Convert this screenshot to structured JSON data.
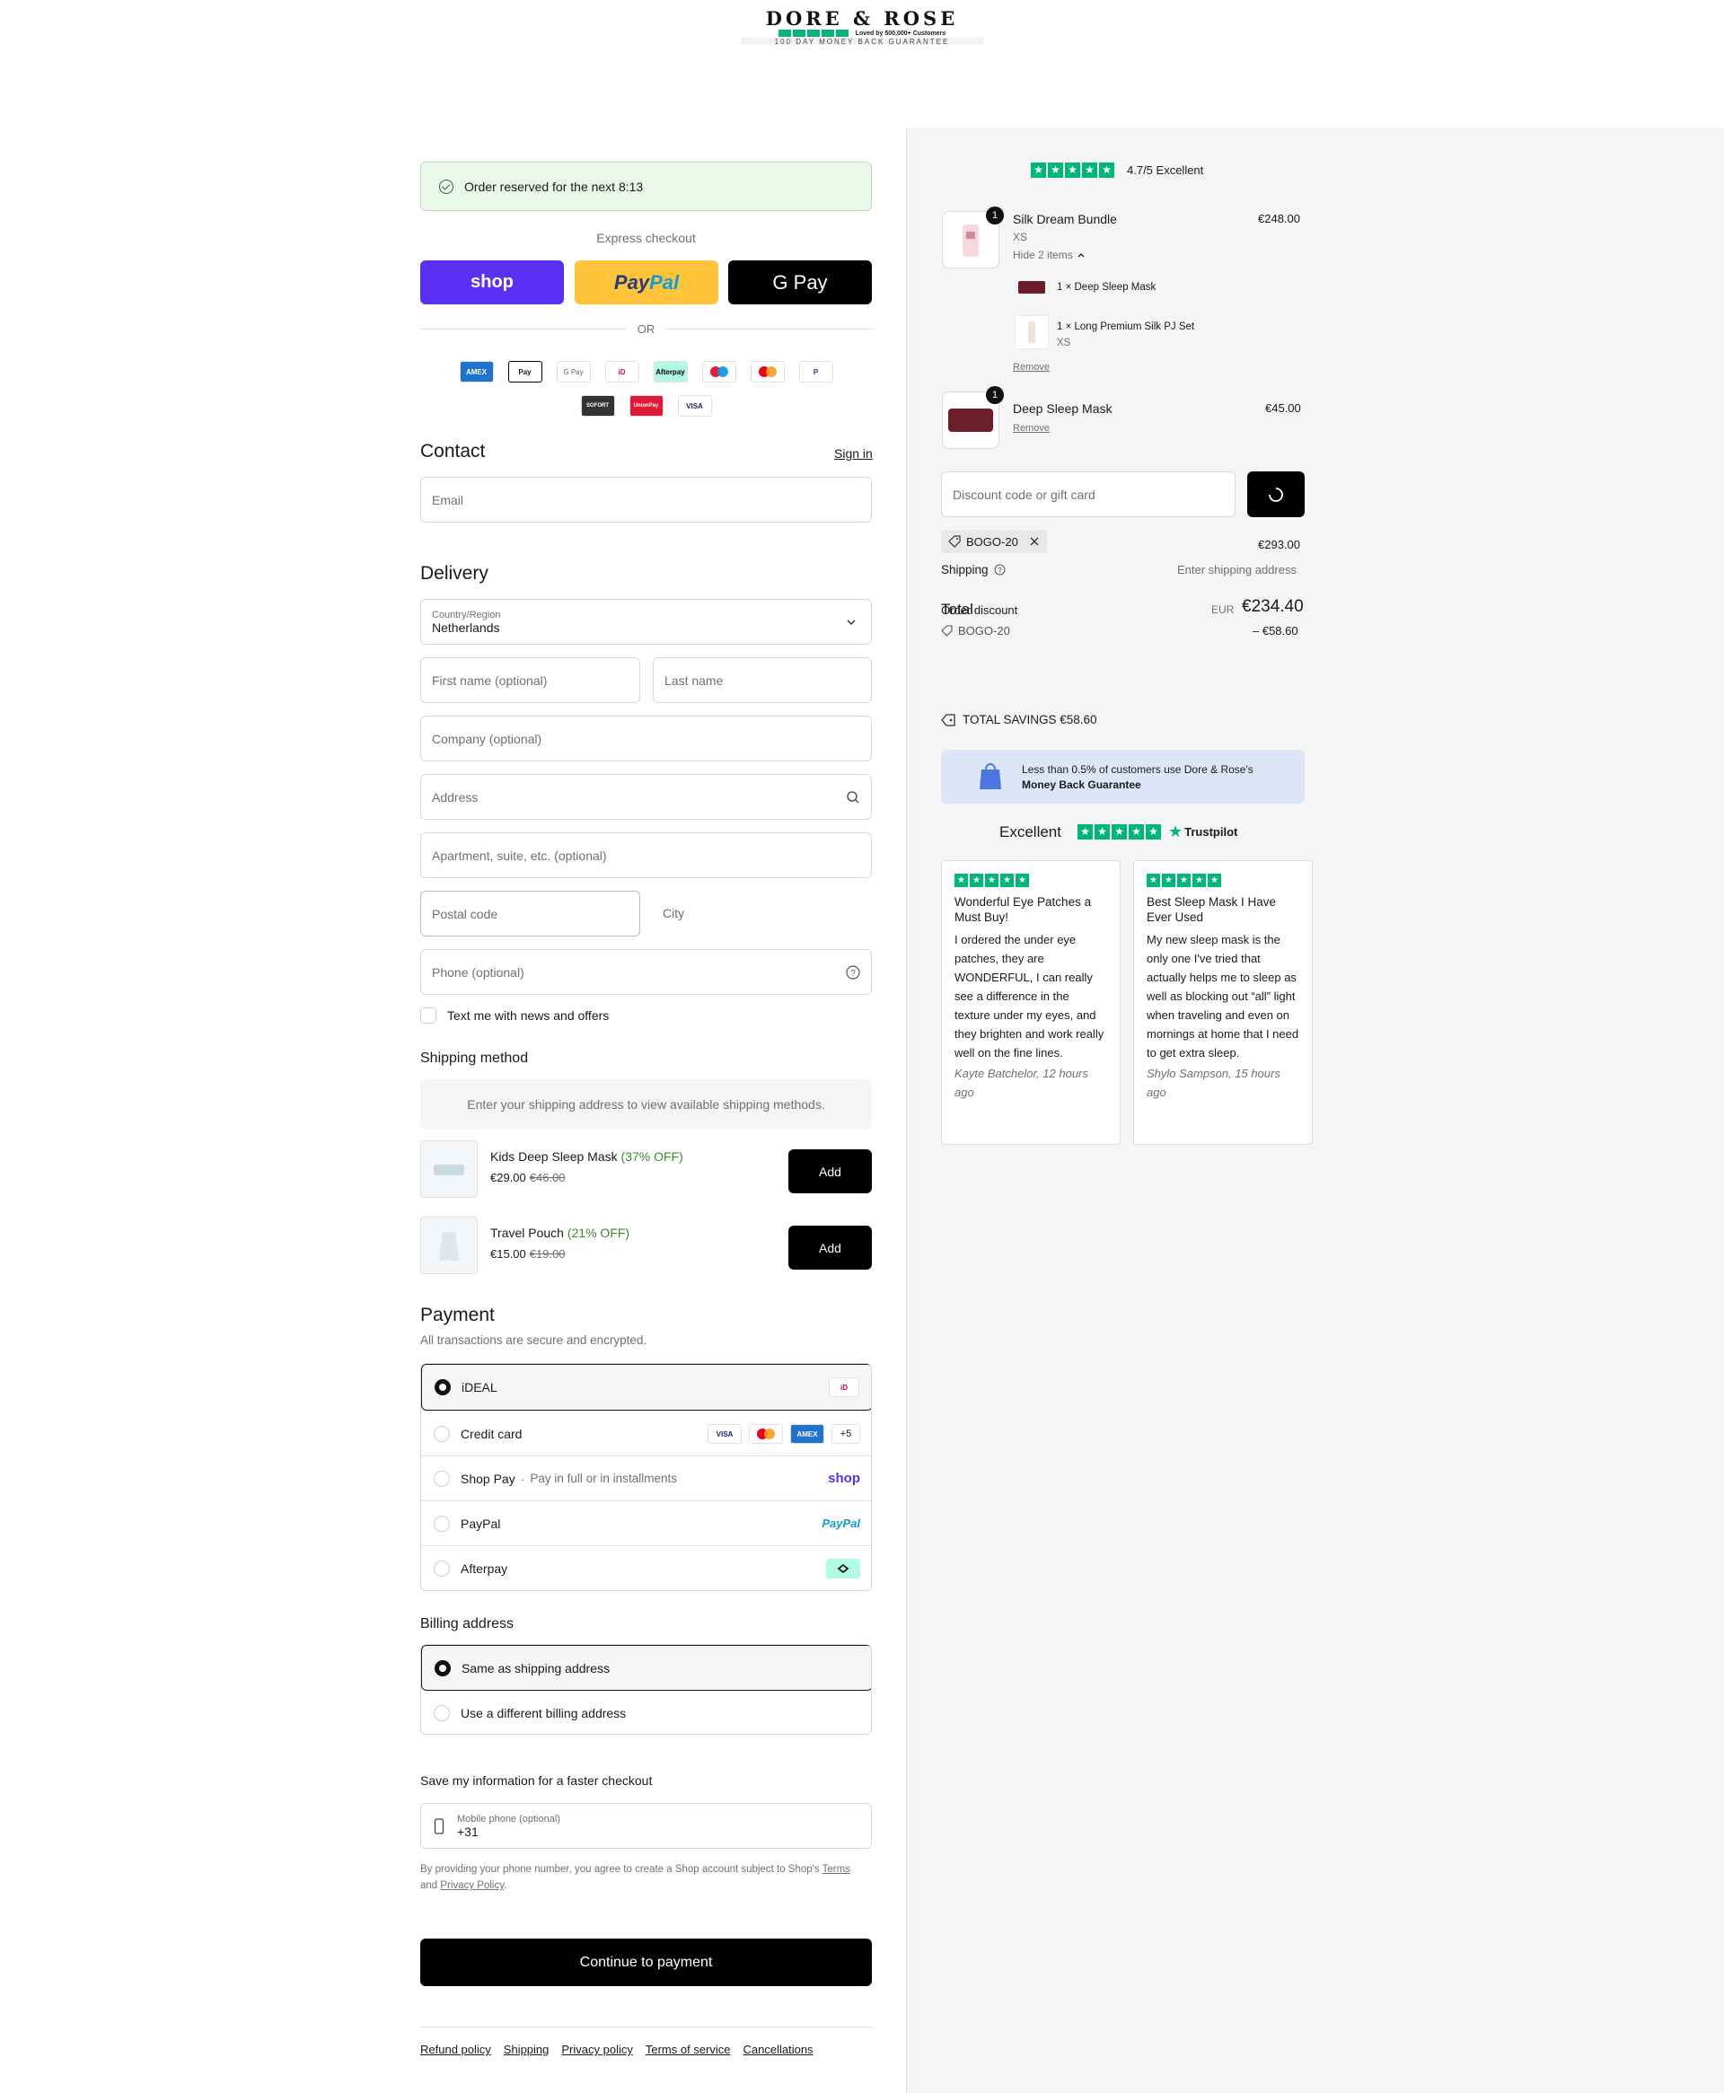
{
  "header": {
    "brand": "DORE & ROSE",
    "loved": "Loved by 500,000+ Customers",
    "guarantee": "100 DAY MONEY BACK GUARANTEE"
  },
  "reservation": {
    "text": "Order reserved for the next 8:13"
  },
  "express": {
    "label": "Express checkout",
    "shop": "shop",
    "paypal_a": "Pay",
    "paypal_b": "Pal",
    "gpay": "G Pay",
    "or": "OR"
  },
  "payment_icons": [
    "AMEX",
    "Pay",
    "G Pay",
    "iD",
    "Afterpay",
    "Maestro",
    "Mastercard",
    "P",
    "SOFORT",
    "UnionPay",
    "VISA"
  ],
  "contact": {
    "title": "Contact",
    "sign_in": "Sign in",
    "email_placeholder": "Email"
  },
  "delivery": {
    "title": "Delivery",
    "country_label": "Country/Region",
    "country_value": "Netherlands",
    "first_name": "First name (optional)",
    "last_name": "Last name",
    "company": "Company (optional)",
    "address": "Address",
    "apartment": "Apartment, suite, etc. (optional)",
    "postal": "Postal code",
    "city": "City",
    "phone": "Phone (optional)",
    "text_me": "Text me with news and offers"
  },
  "shipping": {
    "title": "Shipping method",
    "notice": "Enter your shipping address to view available shipping methods."
  },
  "upsells": [
    {
      "name": "Kids Deep Sleep Mask",
      "off": "(37% OFF)",
      "price": "€29.00",
      "was": "€46.00",
      "button": "Add"
    },
    {
      "name": "Travel Pouch",
      "off": "(21% OFF)",
      "price": "€15.00",
      "was": "€19.00",
      "button": "Add"
    }
  ],
  "payment": {
    "title": "Payment",
    "subtitle": "All transactions are secure and encrypted.",
    "options": [
      {
        "label": "iDEAL",
        "selected": true
      },
      {
        "label": "Credit card",
        "selected": false
      },
      {
        "label": "Shop Pay",
        "suffix": "Pay in full or in installments",
        "selected": false
      },
      {
        "label": "PayPal",
        "selected": false
      },
      {
        "label": "Afterpay",
        "selected": false
      }
    ],
    "card_more": "+5",
    "shop_logo": "shop",
    "paypal_logo": "PayPal",
    "visa": "VISA",
    "amex": "AMEX",
    "ideal": "iD"
  },
  "billing": {
    "title": "Billing address",
    "same": "Same as shipping address",
    "different": "Use a different billing address"
  },
  "save_info": {
    "title": "Save my information for a faster checkout",
    "mobile_label": "Mobile phone (optional)",
    "mobile_value": "+31",
    "legal_a": "By providing your phone number, you agree to create a Shop account subject to Shop's",
    "terms": "Terms",
    "legal_b": "and",
    "privacy": "Privacy Policy",
    "legal_end": "."
  },
  "cta": {
    "label": "Continue to payment"
  },
  "footer": {
    "links": [
      "Refund policy",
      "Shipping",
      "Privacy policy",
      "Terms of service",
      "Cancellations"
    ]
  },
  "summary": {
    "rating": "4.7/5 Excellent",
    "items": [
      {
        "name": "Silk Dream Bundle",
        "variant": "XS",
        "price": "€248.00",
        "qty": "1",
        "toggle": "Hide 2 items",
        "remove": "Remove",
        "children": [
          {
            "label": "1 × Deep Sleep Mask",
            "variant": ""
          },
          {
            "label": "1 × Long Premium Silk PJ Set",
            "variant": "XS"
          }
        ]
      },
      {
        "name": "Deep Sleep Mask",
        "price": "€45.00",
        "qty": "1",
        "remove": "Remove"
      }
    ],
    "discount_placeholder": "Discount code or gift card",
    "applied_code": "BOGO-20",
    "subtotal": "€293.00",
    "shipping_label": "Shipping",
    "shipping_value": "Enter shipping address",
    "total_label": "Total",
    "order_discount_label": "Order discount",
    "currency": "EUR",
    "total": "€234.40",
    "discount_code": "BOGO-20",
    "discount_value": "– €58.60",
    "savings": "TOTAL SAVINGS €58.60",
    "banner_line1": "Less than 0.5% of customers use Dore & Rose's",
    "banner_line2": "Money Back Guarantee",
    "tp_excellent": "Excellent",
    "tp_brand": "Trustpilot",
    "reviews": [
      {
        "title": "Wonderful Eye Patches a Must Buy!",
        "body": "I ordered the under eye patches, they are WONDERFUL, I can really see a difference in the texture under my eyes, and they brighten and work really well on the fine lines.",
        "author": "Kayte Batchelor, 12 hours ago"
      },
      {
        "title": "Best Sleep Mask I Have Ever Used",
        "body": "My new sleep mask is the only one I've tried that actually helps me to sleep as well as blocking out “all” light when traveling and even on mornings at home that I need to get extra sleep.",
        "author": "Shylo Sampson, 15 hours ago"
      }
    ]
  },
  "colors": {
    "accent_green": "#00b67a",
    "shop_purple": "#5a31f4",
    "paypal_yellow": "#ffc439"
  }
}
